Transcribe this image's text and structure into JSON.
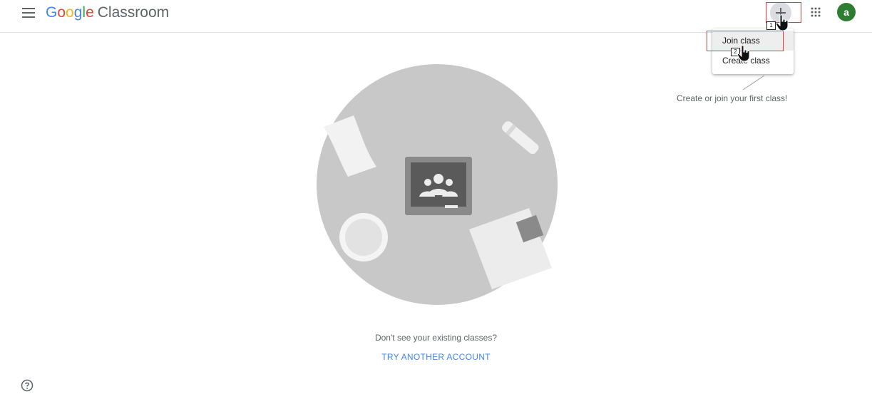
{
  "header": {
    "logo_google": [
      "G",
      "o",
      "o",
      "g",
      "l",
      "e"
    ],
    "product_name": "Classroom",
    "avatar_letter": "a"
  },
  "add_menu": {
    "items": [
      {
        "label": "Join class"
      },
      {
        "label": "Create class"
      }
    ]
  },
  "hint_text": "Create or join your first class!",
  "empty_state": {
    "message": "Don't see your existing classes?",
    "link": "TRY ANOTHER ACCOUNT"
  },
  "annotations": {
    "step1": "1",
    "step2": "2"
  },
  "colors": {
    "google_blue": "#4285F4",
    "google_red": "#EA4335",
    "google_yellow": "#FBBC05",
    "google_green": "#34A853",
    "avatar_bg": "#2e7d32",
    "highlight": "#e53935"
  },
  "icons": {
    "menu": "hamburger-menu-icon",
    "add": "plus-icon",
    "apps": "apps-grid-icon",
    "help": "help-circle-icon"
  }
}
